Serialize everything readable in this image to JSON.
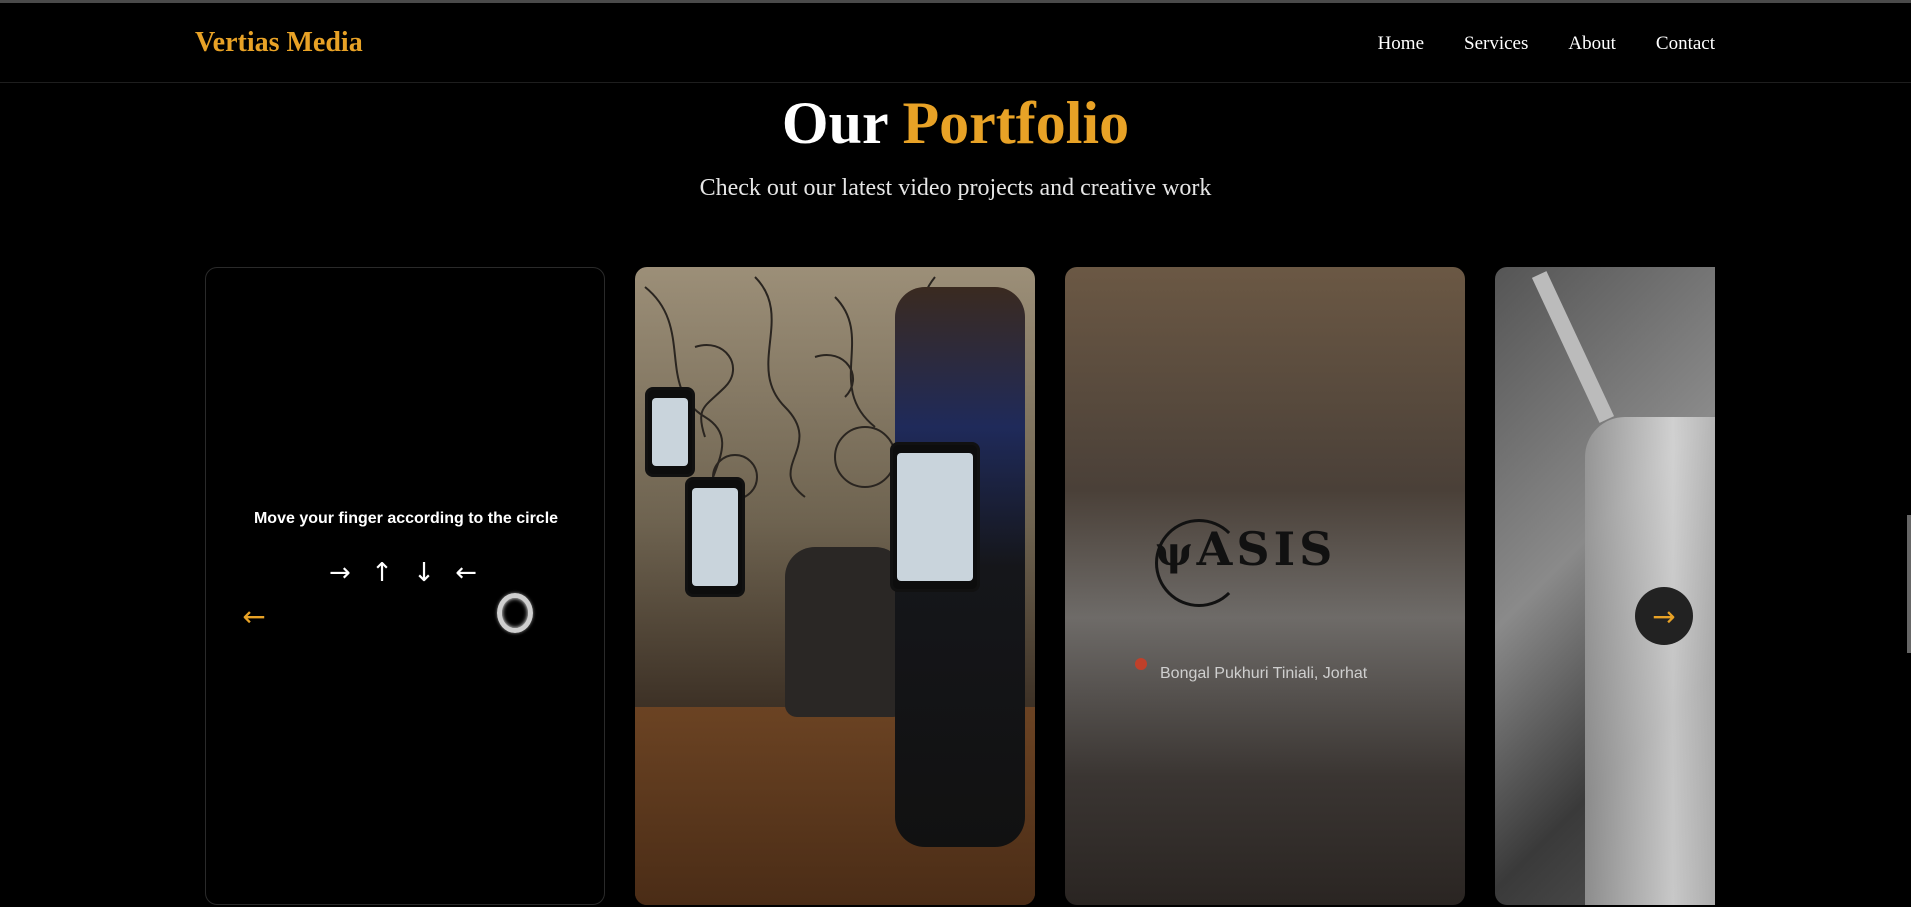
{
  "header": {
    "brand": "Vertias Media",
    "nav": [
      "Home",
      "Services",
      "About",
      "Contact"
    ]
  },
  "hero": {
    "title_part1": "Our",
    "title_part2": "Portfolio",
    "subtitle": "Check out our latest video projects and creative work"
  },
  "carousel": {
    "card1": {
      "hint": "Move your finger according to the circle",
      "gesture": "→ ↑ ↓ ←"
    },
    "card3": {
      "logo_text": "ASIS",
      "location": "Bongal Pukhuri Tiniali, Jorhat"
    },
    "prev_icon": "arrow-left-icon",
    "next_icon": "arrow-right-icon"
  },
  "colors": {
    "accent": "#e8a226",
    "background": "#000000"
  }
}
